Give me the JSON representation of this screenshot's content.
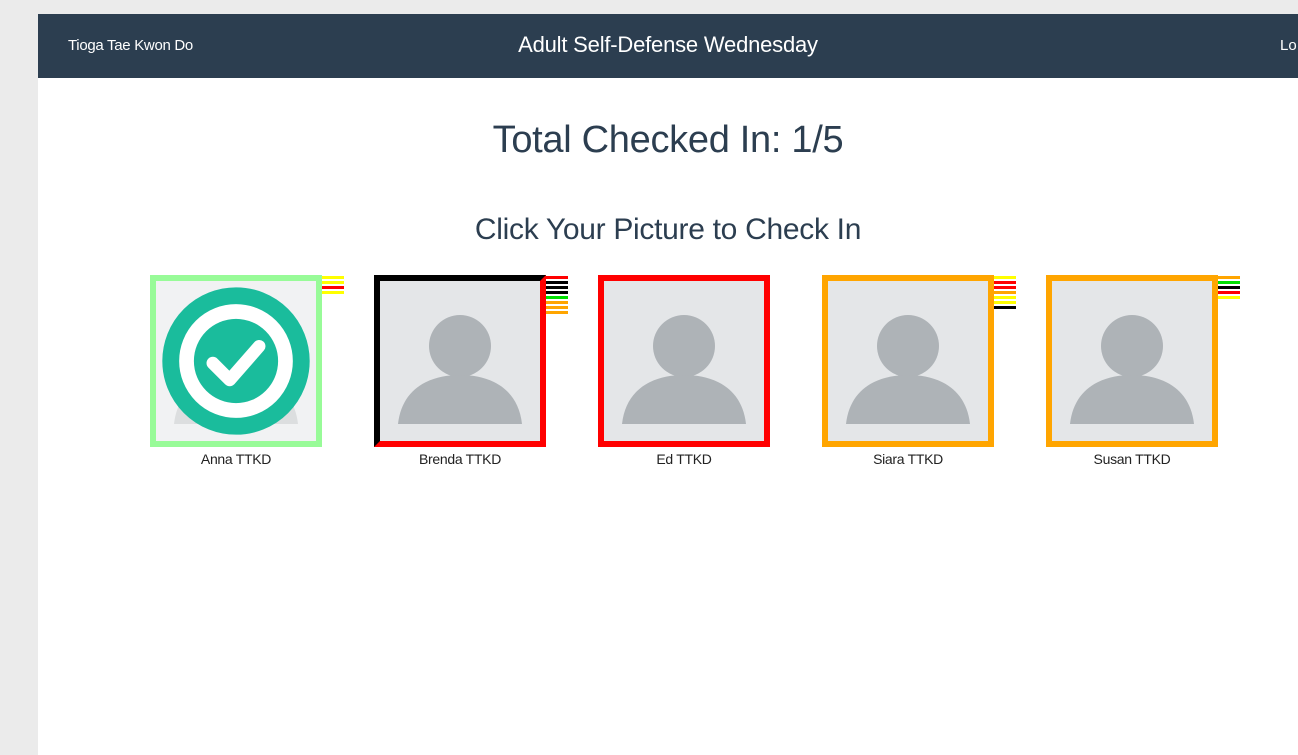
{
  "navbar": {
    "brand": "Tioga Tae Kwon Do",
    "class_name": "Adult Self-Defense Wednesday",
    "logout_label": "Lo"
  },
  "main": {
    "total_checked_in": "Total Checked In: 1/5",
    "instructions": "Click Your Picture to Check In"
  },
  "students": [
    {
      "name": "Anna TTKD",
      "checked_in": true,
      "border_color": "#98fb98",
      "stripes": [
        "#ffff00",
        "#ffff00",
        "#ff0000",
        "#ffff00"
      ]
    },
    {
      "name": "Brenda TTKD",
      "checked_in": false,
      "border_color": "#ff0000",
      "border_accent": "#000000",
      "stripes": [
        "#ff0000",
        "#000000",
        "#000000",
        "#000000",
        "#00e000",
        "#ffa500",
        "#ffa500",
        "#ffa500"
      ]
    },
    {
      "name": "Ed TTKD",
      "checked_in": false,
      "border_color": "#ff0000",
      "stripes": []
    },
    {
      "name": "Siara TTKD",
      "checked_in": false,
      "border_color": "#ffa500",
      "stripes": [
        "#ffff00",
        "#ff0000",
        "#ff0000",
        "#ffa500",
        "#ffff00",
        "#ffff00",
        "#000000"
      ]
    },
    {
      "name": "Susan TTKD",
      "checked_in": false,
      "border_color": "#ffa500",
      "stripes": [
        "#ffa500",
        "#00e000",
        "#000000",
        "#ff0000",
        "#ffff00"
      ]
    }
  ],
  "colors": {
    "navbar": "#2c3e50",
    "check_icon": "#1abc9c",
    "avatar": "#aeb3b7",
    "avatar_faded": "#dcdedf"
  }
}
